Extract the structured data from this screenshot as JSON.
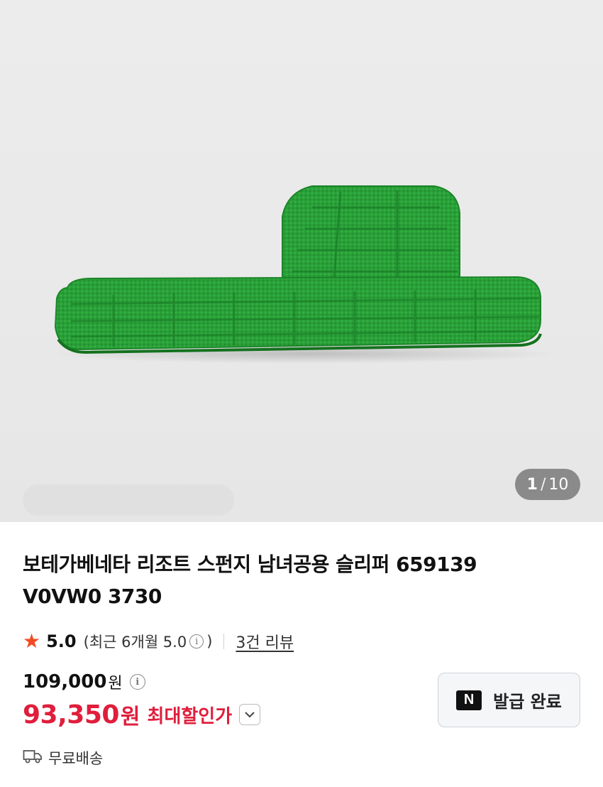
{
  "gallery": {
    "current_index": "1",
    "separator": "/",
    "total": "10"
  },
  "product": {
    "title_line1": "보테가베네타 리조트 스펀지 남녀공용 슬리퍼 659139",
    "title_line2": "V0VW0 3730"
  },
  "rating": {
    "score": "5.0",
    "recent_text": "(최근 6개월 5.0",
    "recent_close": ")",
    "reviews_link": "3건 리뷰"
  },
  "price": {
    "original": "109,000",
    "original_unit": "원",
    "sale": "93,350",
    "sale_unit": "원",
    "max_discount_label": "최대할인가"
  },
  "coupon": {
    "label": "발급 완료",
    "badge": "N"
  },
  "shipping": {
    "label": "무료배송"
  },
  "colors": {
    "sale_red": "#e01e3c",
    "star_orange": "#f24b24",
    "slipper_green": "#2aa33a"
  },
  "icons": [
    "star-icon",
    "info-icon",
    "chevron-down-icon",
    "naver-n-icon",
    "truck-icon"
  ]
}
